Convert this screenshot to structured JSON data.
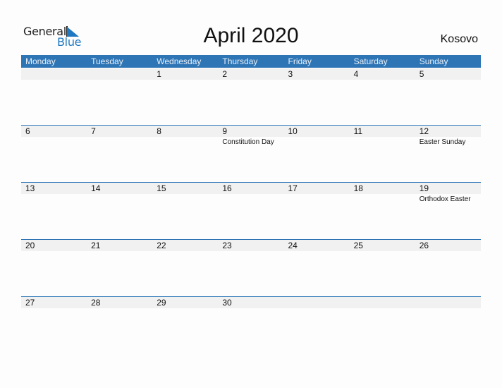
{
  "logo": {
    "word1": "General",
    "word2": "Blue",
    "accent": "#1f78c1"
  },
  "title": "April 2020",
  "country": "Kosovo",
  "colors": {
    "header_bg": "#2e75b6",
    "strip_bg": "#f1f1f1"
  },
  "weekdays": [
    "Monday",
    "Tuesday",
    "Wednesday",
    "Thursday",
    "Friday",
    "Saturday",
    "Sunday"
  ],
  "weeks": [
    [
      {
        "day": "",
        "event": ""
      },
      {
        "day": "",
        "event": ""
      },
      {
        "day": "1",
        "event": ""
      },
      {
        "day": "2",
        "event": ""
      },
      {
        "day": "3",
        "event": ""
      },
      {
        "day": "4",
        "event": ""
      },
      {
        "day": "5",
        "event": ""
      }
    ],
    [
      {
        "day": "6",
        "event": ""
      },
      {
        "day": "7",
        "event": ""
      },
      {
        "day": "8",
        "event": ""
      },
      {
        "day": "9",
        "event": "Constitution Day"
      },
      {
        "day": "10",
        "event": ""
      },
      {
        "day": "11",
        "event": ""
      },
      {
        "day": "12",
        "event": "Easter Sunday"
      }
    ],
    [
      {
        "day": "13",
        "event": ""
      },
      {
        "day": "14",
        "event": ""
      },
      {
        "day": "15",
        "event": ""
      },
      {
        "day": "16",
        "event": ""
      },
      {
        "day": "17",
        "event": ""
      },
      {
        "day": "18",
        "event": ""
      },
      {
        "day": "19",
        "event": "Orthodox Easter"
      }
    ],
    [
      {
        "day": "20",
        "event": ""
      },
      {
        "day": "21",
        "event": ""
      },
      {
        "day": "22",
        "event": ""
      },
      {
        "day": "23",
        "event": ""
      },
      {
        "day": "24",
        "event": ""
      },
      {
        "day": "25",
        "event": ""
      },
      {
        "day": "26",
        "event": ""
      }
    ],
    [
      {
        "day": "27",
        "event": ""
      },
      {
        "day": "28",
        "event": ""
      },
      {
        "day": "29",
        "event": ""
      },
      {
        "day": "30",
        "event": ""
      },
      {
        "day": "",
        "event": ""
      },
      {
        "day": "",
        "event": ""
      },
      {
        "day": "",
        "event": ""
      }
    ]
  ]
}
